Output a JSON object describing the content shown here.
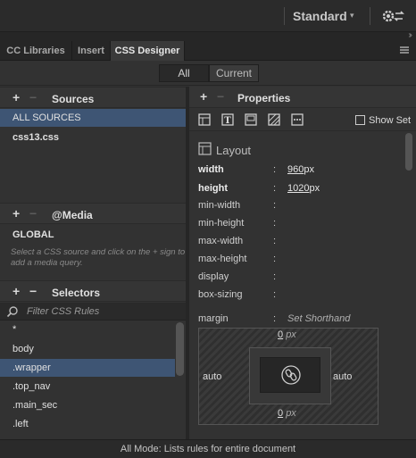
{
  "topbar": {
    "workspace": "Standard",
    "caret": "▾"
  },
  "tabs": [
    {
      "label": "CC Libraries"
    },
    {
      "label": "Insert"
    },
    {
      "label": "CSS Designer"
    }
  ],
  "mode": {
    "all": "All",
    "current": "Current"
  },
  "sources": {
    "title": "Sources",
    "items": [
      "ALL SOURCES",
      "css13.css"
    ],
    "selected": "ALL SOURCES"
  },
  "media": {
    "title": "@Media",
    "global": "GLOBAL",
    "hint": "Select a CSS source and click on the + sign to add a media query."
  },
  "selectors": {
    "title": "Selectors",
    "filter_placeholder": "Filter CSS Rules",
    "items": [
      "*",
      "body",
      ".wrapper",
      ".top_nav",
      ".main_sec",
      ".left"
    ],
    "selected": ".wrapper"
  },
  "properties": {
    "title": "Properties",
    "show_set": "Show Set",
    "category": "Layout",
    "rows": [
      {
        "name": "width",
        "value": "960",
        "unit": "px",
        "set": true
      },
      {
        "name": "height",
        "value": "1020",
        "unit": "px",
        "set": true
      },
      {
        "name": "min-width",
        "value": "",
        "unit": "",
        "set": false
      },
      {
        "name": "min-height",
        "value": "",
        "unit": "",
        "set": false
      },
      {
        "name": "max-width",
        "value": "",
        "unit": "",
        "set": false
      },
      {
        "name": "max-height",
        "value": "",
        "unit": "",
        "set": false
      },
      {
        "name": "display",
        "value": "",
        "unit": "",
        "set": false
      },
      {
        "name": "box-sizing",
        "value": "",
        "unit": "",
        "set": false
      }
    ],
    "margin": {
      "name": "margin",
      "shorthand": "Set Shorthand",
      "top": "0",
      "bottom": "0",
      "left": "auto",
      "right": "auto",
      "unit": "px"
    }
  },
  "status": "All Mode: Lists rules for entire document"
}
